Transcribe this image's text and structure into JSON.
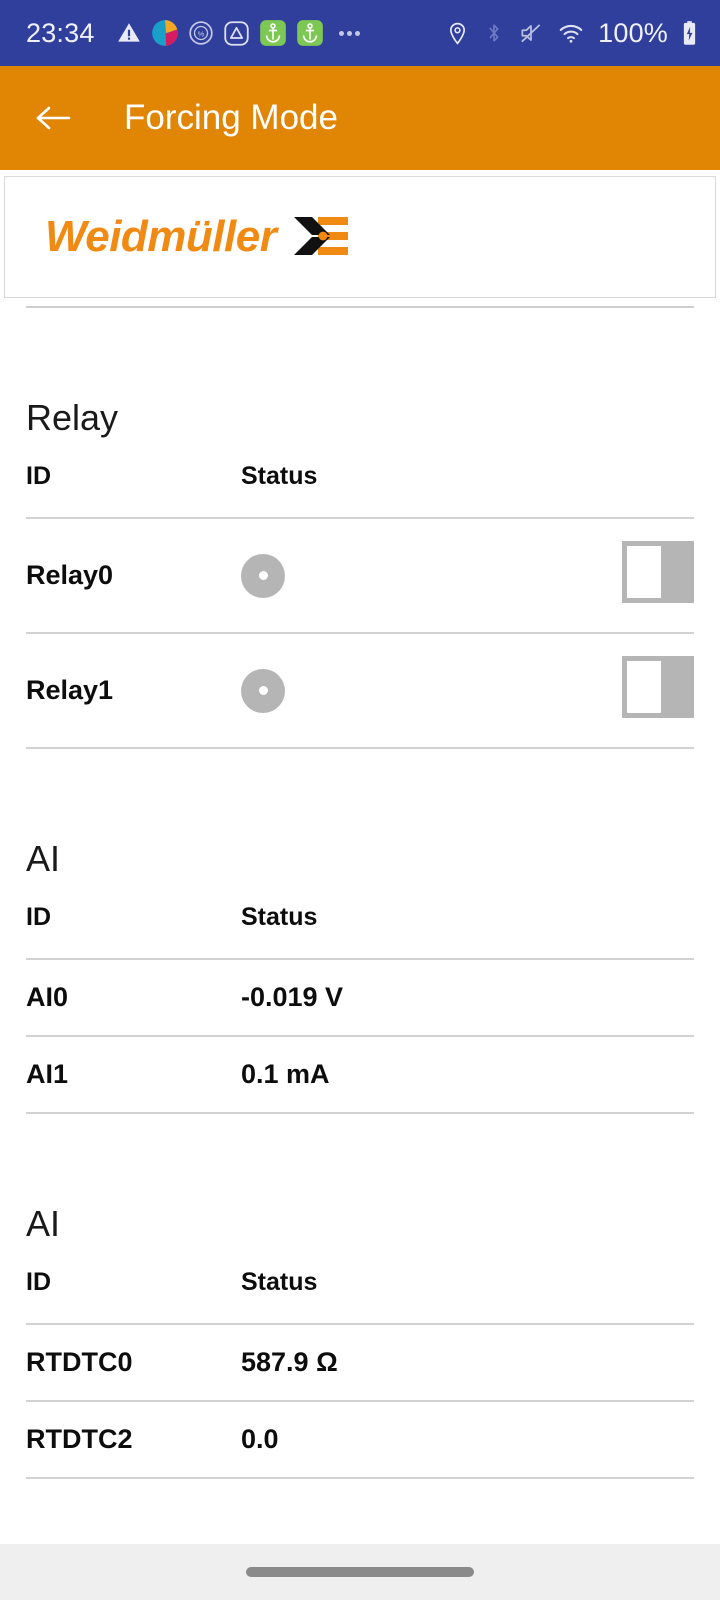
{
  "statusbar": {
    "time": "23:34",
    "battery_percent": "100%",
    "left_icons": [
      "warning-triangle-icon",
      "app-logo-colored-icon",
      "battery-saver-percent-icon",
      "triangle-badge-icon",
      "anchor-badge-icon",
      "anchor-badge-icon",
      "more-dots-icon"
    ],
    "right_icons": [
      "location-pin-icon",
      "bluetooth-icon",
      "volume-muted-icon",
      "wifi-icon",
      "battery-charging-icon"
    ]
  },
  "appbar": {
    "back_label": "back-arrow",
    "title": "Forcing Mode",
    "background_color": "#E08504"
  },
  "brand": {
    "name": "Weidmüller",
    "logo_orange": "#F08A13",
    "logo_black": "#111111"
  },
  "colors": {
    "status_bar_blue": "#303E9C",
    "accent_orange": "#E08504",
    "indicator_grey": "#B5B5B5",
    "divider_grey": "#d2d2d2"
  },
  "sections": [
    {
      "title": "Relay",
      "columns": [
        "ID",
        "Status"
      ],
      "rows": [
        {
          "id": "Relay0",
          "status_type": "indicator",
          "status_value": "",
          "control": "toggle",
          "control_state": "off"
        },
        {
          "id": "Relay1",
          "status_type": "indicator",
          "status_value": "",
          "control": "toggle",
          "control_state": "off"
        }
      ]
    },
    {
      "title": "AI",
      "columns": [
        "ID",
        "Status"
      ],
      "rows": [
        {
          "id": "AI0",
          "status_type": "text",
          "status_value": "-0.019 V",
          "control": "none",
          "control_state": ""
        },
        {
          "id": "AI1",
          "status_type": "text",
          "status_value": "0.1 mA",
          "control": "none",
          "control_state": ""
        }
      ]
    },
    {
      "title": "AI",
      "columns": [
        "ID",
        "Status"
      ],
      "rows": [
        {
          "id": "RTDTC0",
          "status_type": "text",
          "status_value": "587.9 Ω",
          "control": "none",
          "control_state": ""
        },
        {
          "id": "RTDTC2",
          "status_type": "text",
          "status_value": "0.0",
          "control": "none",
          "control_state": ""
        }
      ]
    }
  ],
  "navbar": {
    "handle": "gesture-handle"
  }
}
